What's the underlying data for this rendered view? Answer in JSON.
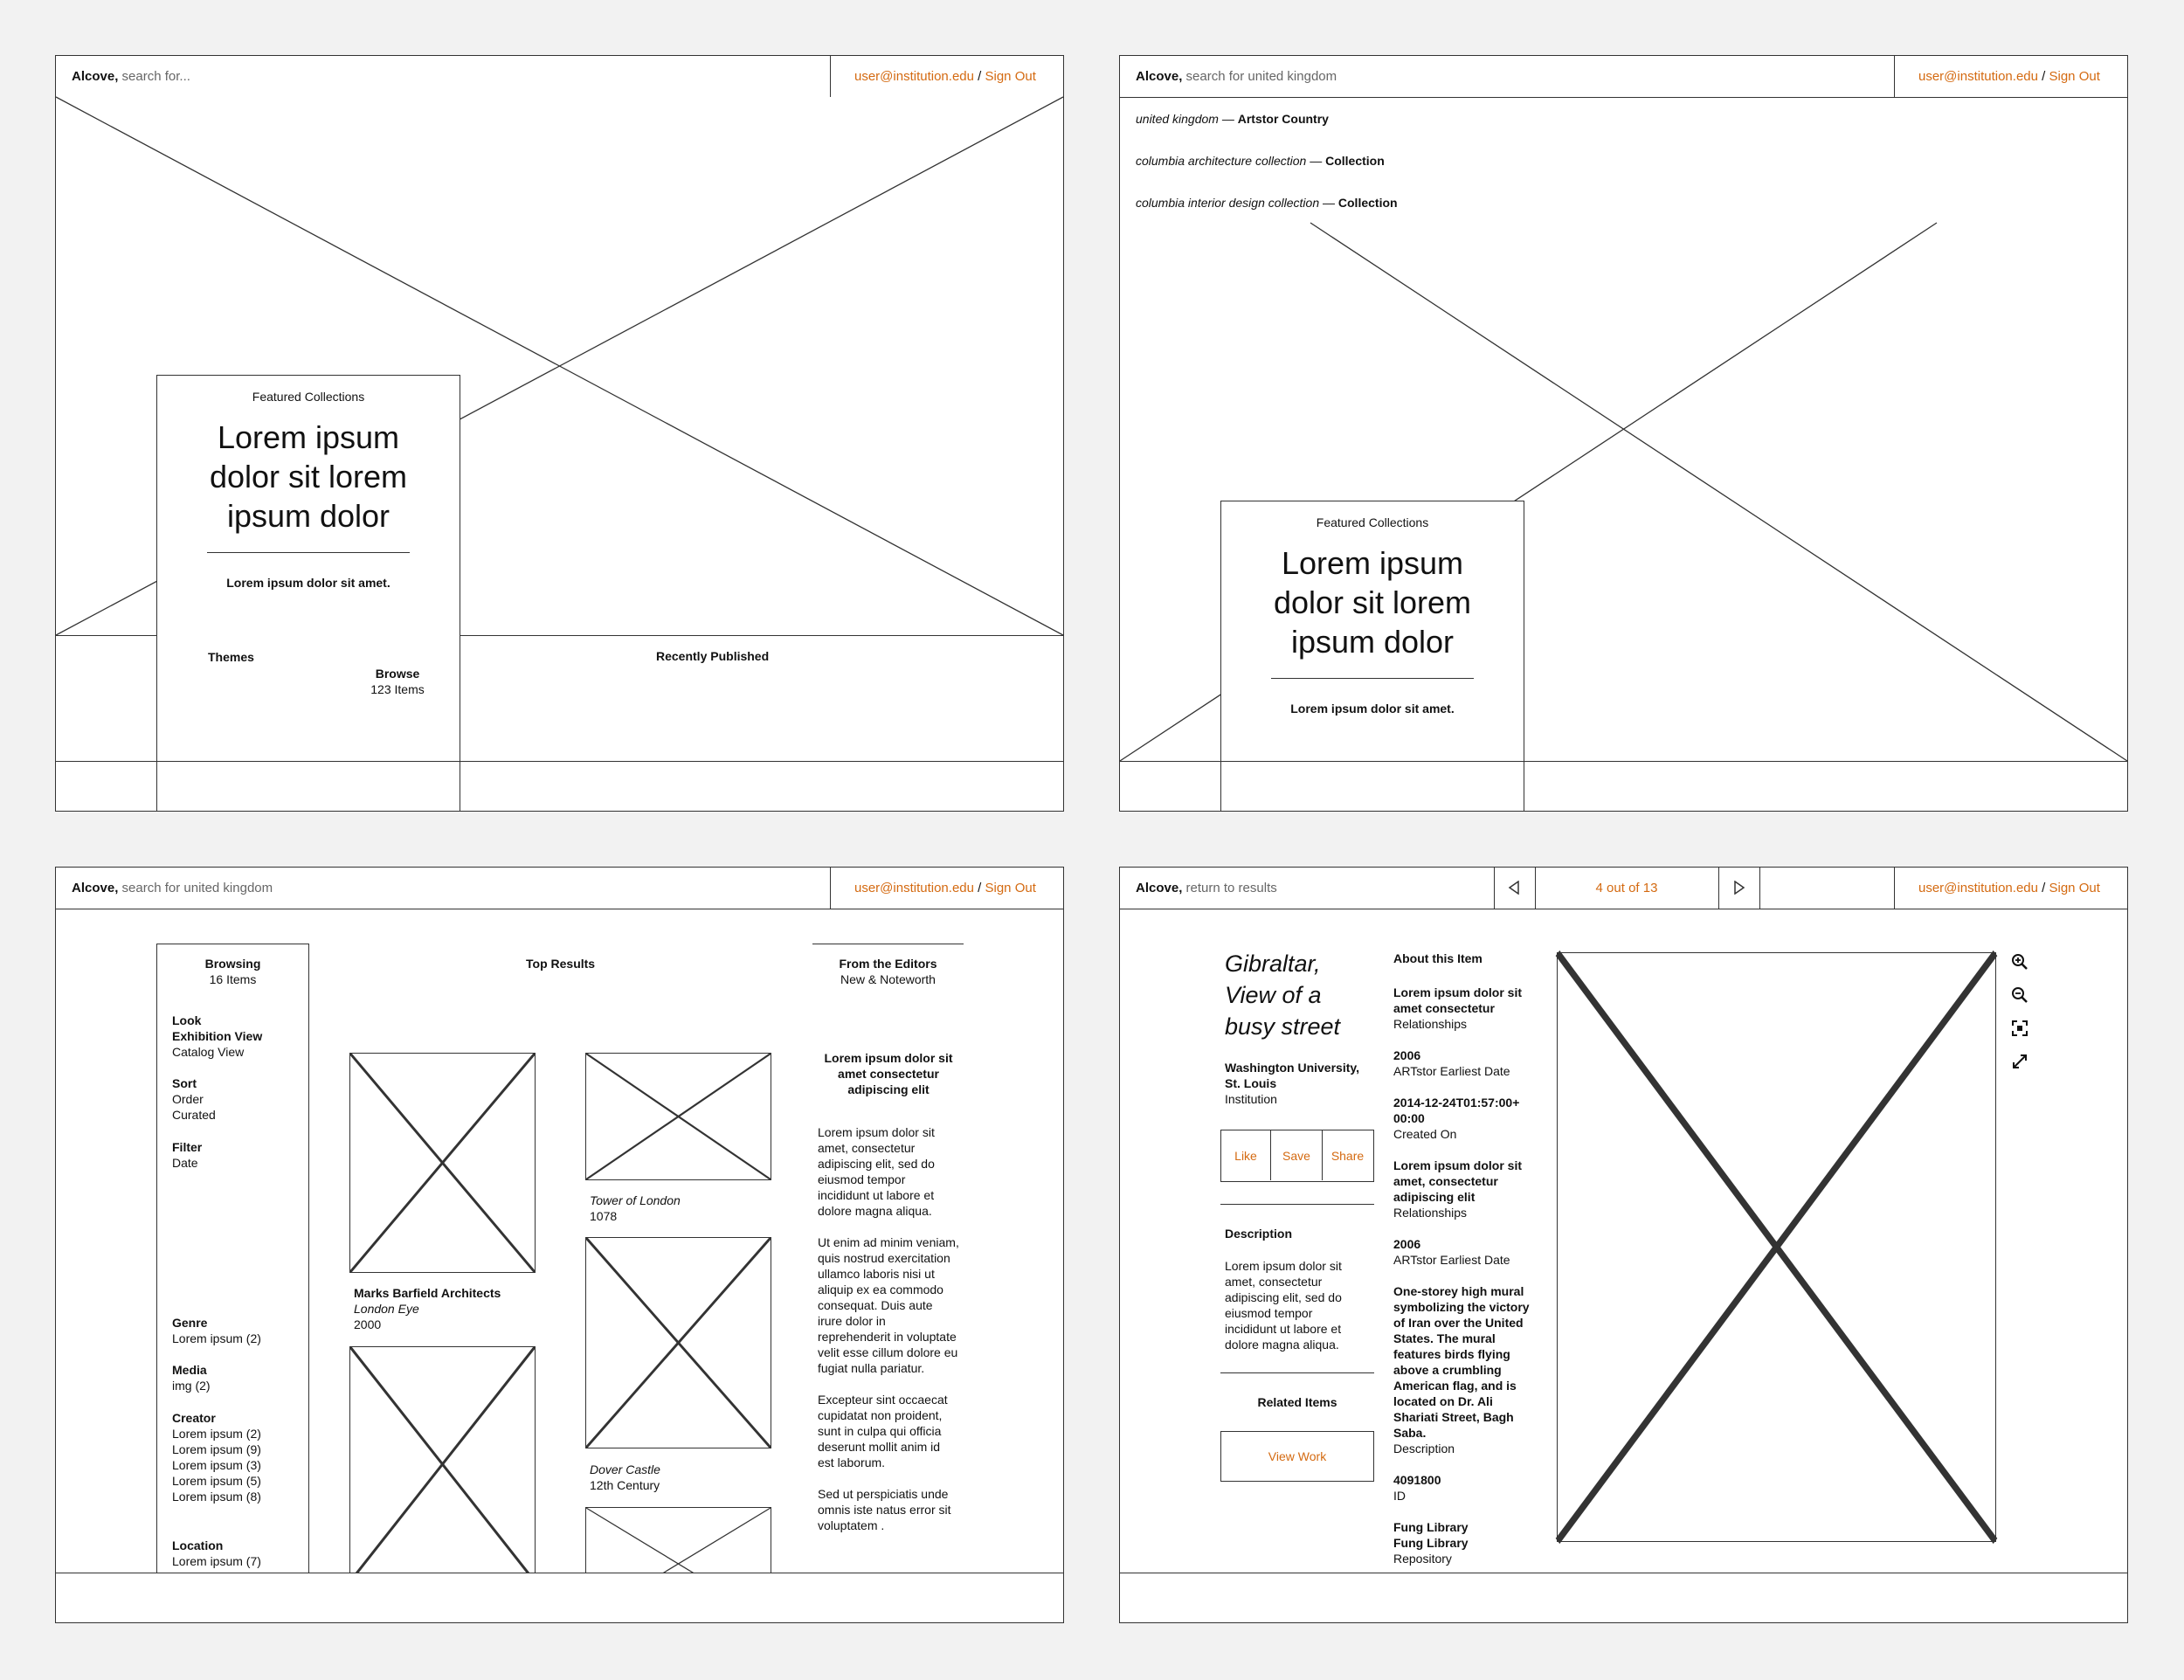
{
  "colors": {
    "accent": "#d46a11",
    "line": "#333333",
    "background": "#f2f2f2"
  },
  "header": {
    "brand": "Alcove,",
    "user": "user@institution.edu",
    "separator": "/",
    "signout": "Sign Out"
  },
  "frame1": {
    "search_placeholder": "search for...",
    "featured_label": "Featured Collections",
    "featured_title": "Lorem ipsum dolor sit lorem ipsum dolor",
    "featured_sub": "Lorem ipsum dolor sit amet.",
    "themes": "Themes",
    "browse": "Browse",
    "browse_count": "123 Items",
    "recently": "Recently Published"
  },
  "frame2": {
    "search_value": "search for united kingdom",
    "suggestions": [
      {
        "term": "united kingdom",
        "dash": "—",
        "type": "Artstor Country"
      },
      {
        "term": "columbia architecture collection",
        "dash": "—",
        "type": "Collection"
      },
      {
        "term": "columbia interior design collection",
        "dash": "—",
        "type": "Collection"
      }
    ],
    "featured_label": "Featured Collections",
    "featured_title": "Lorem ipsum dolor sit lorem ipsum dolor",
    "featured_sub": "Lorem ipsum dolor sit amet."
  },
  "frame3": {
    "search_value": "search for united kingdom",
    "sidebar": {
      "browsing": "Browsing",
      "count": "16 Items",
      "look": "Look",
      "look_items": [
        "Exhibition View",
        "Catalog View"
      ],
      "sort": "Sort",
      "sort_items": [
        "Order",
        "Curated"
      ],
      "filter": "Filter",
      "filter_items": [
        "Date"
      ],
      "genre": "Genre",
      "genre_items": [
        "Lorem ipsum (2)"
      ],
      "media": "Media",
      "media_items": [
        "img (2)"
      ],
      "creator": "Creator",
      "creator_items": [
        "Lorem ipsum (2)",
        "Lorem ipsum (9)",
        "Lorem ipsum (3)",
        "Lorem ipsum (5)",
        "Lorem ipsum (8)"
      ],
      "location": "Location",
      "location_items": [
        "Lorem ipsum (7)"
      ]
    },
    "top_results": "Top Results",
    "results": {
      "a_creator": "Marks Barfield Architects",
      "a_title": "London Eye",
      "a_date": "2000",
      "b_title": "Tower of London",
      "b_date": "1078",
      "c_title": "Dover Castle",
      "c_date": "12th Century"
    },
    "editors": {
      "title": "From the Editors",
      "sub": "New & Noteworth",
      "heading": "Lorem ipsum dolor sit amet consectetur adipiscing elit",
      "p1": "Lorem ipsum dolor sit amet, consectetur adipiscing elit, sed do eiusmod tempor incididunt ut labore et dolore magna aliqua.",
      "p2": "Ut enim ad minim veniam, quis nostrud exercitation ullamco laboris nisi ut aliquip ex ea commodo consequat. Duis aute irure dolor in reprehenderit in voluptate velit esse cillum dolore eu fugiat nulla pariatur.",
      "p3": "Excepteur sint occaecat cupidatat non proident, sunt in culpa qui officia deserunt mollit anim id est laborum.",
      "p4": "Sed ut perspiciatis unde omnis iste natus error sit voluptatem ."
    }
  },
  "frame4": {
    "return": "return to results",
    "pager": "4 out of 13",
    "item_title": "Gibraltar, View of a busy street",
    "institution": "Washington University, St. Louis",
    "institution_label": "Institution",
    "like": "Like",
    "save": "Save",
    "share": "Share",
    "description_label": "Description",
    "description": "Lorem ipsum dolor sit amet, consectetur adipiscing elit, sed do eiusmod tempor incididunt ut labore et dolore magna aliqua.",
    "related_label": "Related Items",
    "view_work": "View Work",
    "about": "About this Item",
    "fields": [
      {
        "value": "Lorem ipsum dolor sit amet consectetur",
        "label": "Relationships"
      },
      {
        "value": "2006",
        "label": "ARTstor Earliest Date"
      },
      {
        "value": "2014-12-24T01:57:00+ 00:00",
        "label": "Created On"
      },
      {
        "value": "Lorem ipsum dolor sit amet, consectetur adipiscing elit",
        "label": "Relationships"
      },
      {
        "value": "2006",
        "label": "ARTstor Earliest Date"
      },
      {
        "value": "One-storey high mural symbolizing the victory of Iran over the United States. The mural features birds flying above a crumbling American flag, and is located on Dr. Ali Shariati Street, Bagh Saba.",
        "label": "Description"
      },
      {
        "value": "4091800",
        "label": "ID"
      },
      {
        "value": "Fung Library Fung Library",
        "label": "Repository"
      }
    ],
    "icons": [
      "zoom-in-icon",
      "zoom-out-icon",
      "fit-screen-icon",
      "fullscreen-icon"
    ]
  }
}
